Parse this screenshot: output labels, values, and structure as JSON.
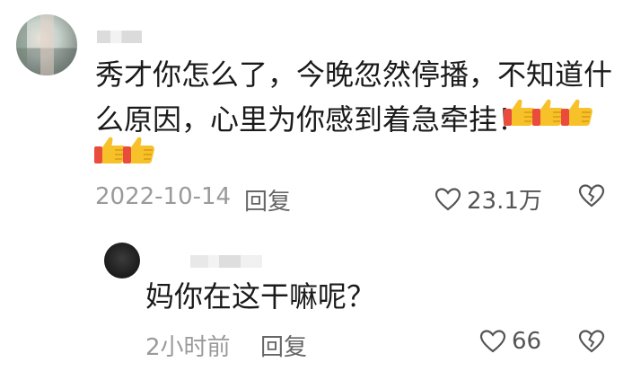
{
  "comment": {
    "text": "秀才你怎么了，今晚忽然停播，不知道什么原因，心里为你感到着急牵挂！",
    "emoji": "thumbs-up",
    "emoji_count": 5,
    "date": "2022-10-14",
    "reply_label": "回复",
    "likes": "23.1万"
  },
  "reply": {
    "text": "妈你在这干嘛呢？",
    "time": "2小时前",
    "reply_label": "回复",
    "likes": "66"
  },
  "colors": {
    "text": "#1a1a1a",
    "meta": "#9a9a9a",
    "thumb_yellow": "#f7c12a",
    "thumb_red": "#e94b3c"
  }
}
